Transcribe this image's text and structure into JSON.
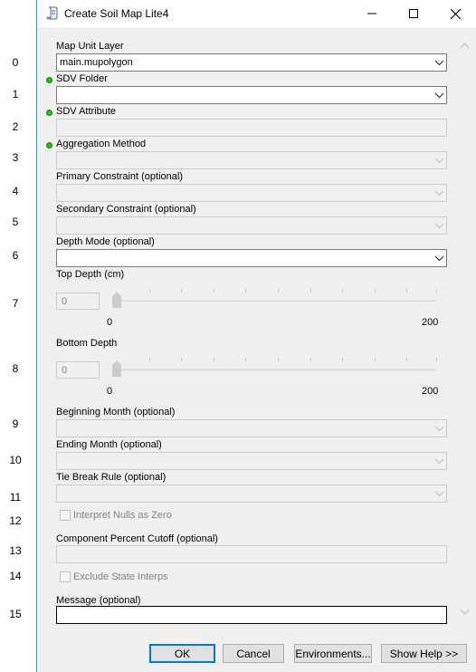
{
  "window": {
    "title": "Create Soil Map Lite4"
  },
  "row_numbers": [
    "0",
    "1",
    "2",
    "3",
    "4",
    "5",
    "6",
    "7",
    "8",
    "9",
    "10",
    "11",
    "12",
    "13",
    "14",
    "15"
  ],
  "form": {
    "map_unit_layer": {
      "label": "Map Unit Layer",
      "value": "main.mupolygon"
    },
    "sdv_folder": {
      "label": "SDV Folder",
      "value": ""
    },
    "sdv_attribute": {
      "label": "SDV Attribute",
      "value": ""
    },
    "aggregation_method": {
      "label": "Aggregation Method",
      "value": ""
    },
    "primary_constraint": {
      "label": "Primary Constraint (optional)",
      "value": ""
    },
    "secondary_constraint": {
      "label": "Secondary Constraint (optional)",
      "value": ""
    },
    "depth_mode": {
      "label": "Depth Mode (optional)",
      "value": ""
    },
    "top_depth": {
      "label": "Top Depth (cm)",
      "value": "0",
      "min": "0",
      "max": "200",
      "level": 0
    },
    "bottom_depth": {
      "label": "Bottom Depth",
      "value": "0",
      "min": "0",
      "max": "200",
      "level": 0
    },
    "beginning_month": {
      "label": "Beginning Month (optional)",
      "value": ""
    },
    "ending_month": {
      "label": "Ending Month (optional)",
      "value": ""
    },
    "tie_break_rule": {
      "label": "Tie Break Rule (optional)",
      "value": ""
    },
    "interpret_nulls": {
      "label": "Interpret Nulls as Zero",
      "checked": false
    },
    "component_cutoff": {
      "label": "Component Percent Cutoff (optional)",
      "value": ""
    },
    "exclude_state": {
      "label": "Exclude State Interps",
      "checked": false
    },
    "message": {
      "label": "Message (optional)",
      "value": ""
    }
  },
  "buttons": {
    "ok": "OK",
    "cancel": "Cancel",
    "environments": "Environments...",
    "show_help": "Show Help >>"
  },
  "colors": {
    "required_dot": "#21c321",
    "accent": "#0078d7",
    "window_border": "#1e9fbf"
  }
}
